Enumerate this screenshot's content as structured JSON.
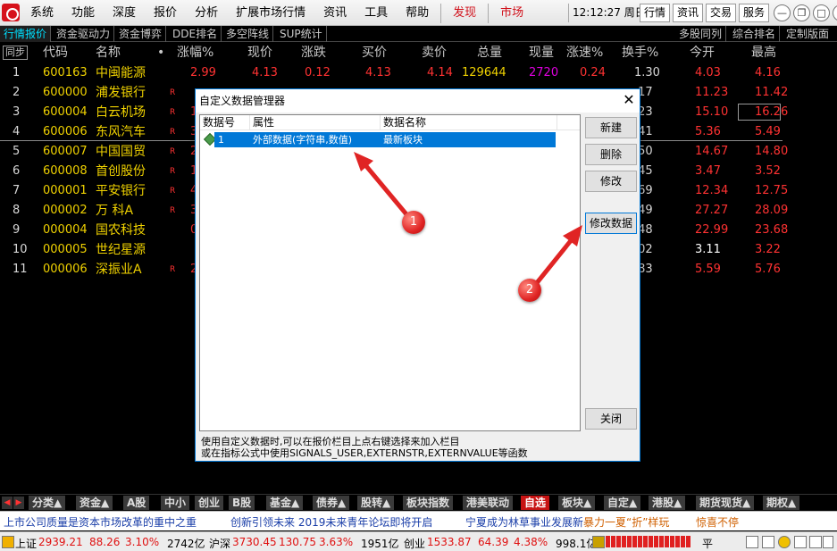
{
  "menu": [
    "系统",
    "功能",
    "深度",
    "报价",
    "分析",
    "扩展市场行情",
    "资讯",
    "工具",
    "帮助"
  ],
  "menu_red": [
    "发现",
    "市场"
  ],
  "clock": "12:12:27 周日",
  "top_buttons": [
    "行情",
    "资讯",
    "交易",
    "服务"
  ],
  "win_controls": [
    "—",
    "❐",
    "□",
    "✕"
  ],
  "tabs": [
    "行情报价",
    "资金驱动力",
    "资金博弈",
    "DDE排名",
    "多空阵线",
    "SUP统计"
  ],
  "tabs_right": [
    "多股同列",
    "综合排名",
    "定制版面"
  ],
  "sync": "同步",
  "columns": [
    "代码",
    "名称",
    "•",
    "涨幅%",
    "现价",
    "涨跌",
    "买价",
    "卖价",
    "总量",
    "现量",
    "涨速%",
    "换手%",
    "今开",
    "最高"
  ],
  "rows": [
    {
      "no": "1",
      "code": "600163",
      "name": "中闽能源",
      "mark": "",
      "pct": "2.99",
      "price": "4.13",
      "chg": "0.12",
      "bid": "4.13",
      "ask": "4.14",
      "vol": "129644",
      "cur": "2720",
      "spd": "0.24",
      "turn": "1.30",
      "open": "4.03",
      "high": "4.16"
    },
    {
      "no": "2",
      "code": "600000",
      "name": "浦发银行",
      "mark": "R",
      "pct": "",
      "price": "",
      "chg": "",
      "bid": "",
      "ask": "",
      "vol": "",
      "cur": "",
      "spd": "",
      "turn": ".17",
      "open": "11.23",
      "high": "11.42"
    },
    {
      "no": "3",
      "code": "600004",
      "name": "白云机场",
      "mark": "R",
      "pct": "10",
      "price": "",
      "chg": "",
      "bid": "",
      "ask": "",
      "vol": "",
      "cur": "",
      "spd": "",
      "turn": ".23",
      "open": "15.10",
      "high": "16.26"
    },
    {
      "no": "4",
      "code": "600006",
      "name": "东风汽车",
      "mark": "R",
      "pct": "3",
      "price": "",
      "chg": "",
      "bid": "",
      "ask": "",
      "vol": "",
      "cur": "",
      "spd": "",
      "turn": ".41",
      "open": "5.36",
      "high": "5.49"
    },
    {
      "no": "5",
      "code": "600007",
      "name": "中国国贸",
      "mark": "R",
      "pct": "2",
      "price": "",
      "chg": "",
      "bid": "",
      "ask": "",
      "vol": "",
      "cur": "",
      "spd": "",
      "turn": ".50",
      "open": "14.67",
      "high": "14.80"
    },
    {
      "no": "6",
      "code": "600008",
      "name": "首创股份",
      "mark": "R",
      "pct": "1",
      "price": "",
      "chg": "",
      "bid": "",
      "ask": "",
      "vol": "",
      "cur": "",
      "spd": "",
      "turn": ".45",
      "open": "3.47",
      "high": "3.52"
    },
    {
      "no": "7",
      "code": "000001",
      "name": "平安银行",
      "mark": "R",
      "pct": "4",
      "price": "",
      "chg": "",
      "bid": "",
      "ask": "",
      "vol": "",
      "cur": "",
      "spd": "",
      "turn": ".69",
      "open": "12.34",
      "high": "12.75"
    },
    {
      "no": "8",
      "code": "000002",
      "name": "万 科A",
      "mark": "R",
      "pct": "3",
      "price": "",
      "chg": "",
      "bid": "",
      "ask": "",
      "vol": "",
      "cur": "",
      "spd": "",
      "turn": ".49",
      "open": "27.27",
      "high": "28.09"
    },
    {
      "no": "9",
      "code": "000004",
      "name": "国农科技",
      "mark": "",
      "pct": "0",
      "price": "",
      "chg": "",
      "bid": "",
      "ask": "",
      "vol": "",
      "cur": "",
      "spd": "",
      "turn": ".48",
      "open": "22.99",
      "high": "23.68"
    },
    {
      "no": "10",
      "code": "000005",
      "name": "世纪星源",
      "mark": "",
      "pct": "",
      "price": "",
      "chg": "",
      "bid": "",
      "ask": "",
      "vol": "",
      "cur": "",
      "spd": "",
      "turn": ".02",
      "open": "3.11",
      "high": "3.22"
    },
    {
      "no": "11",
      "code": "000006",
      "name": "深振业A",
      "mark": "R",
      "pct": "2",
      "price": "",
      "chg": "",
      "bid": "",
      "ask": "",
      "vol": "",
      "cur": "",
      "spd": "",
      "turn": ".83",
      "open": "5.59",
      "high": "5.76"
    }
  ],
  "dialog": {
    "title": "自定义数据管理器",
    "close": "✕",
    "list_headers": [
      "数据号",
      "属性",
      "数据名称"
    ],
    "item": {
      "id": "1",
      "attr": "外部数据(字符串,数值)",
      "name": "最新板块"
    },
    "buttons": [
      "新建",
      "删除",
      "修改",
      "修改数据",
      "关闭"
    ],
    "help_line1": "使用自定义数据时,可以在报价栏目上点右键选择来加入栏目",
    "help_line2": "或在指标公式中使用SIGNALS_USER,EXTERNSTR,EXTERNVALUE等函数"
  },
  "callouts": [
    "1",
    "2"
  ],
  "bottom_tabs": [
    "分类▲",
    "资金▲",
    "A股",
    "中小",
    "创业",
    "B股",
    "基金▲",
    "债券▲",
    "股转▲",
    "板块指数",
    "港美联动",
    "自选",
    "板块▲",
    "自定▲",
    "港股▲",
    "期货现货▲",
    "期权▲"
  ],
  "news": [
    "上市公司质量是资本市场改革的重中之重",
    "创新引领未来 2019未来青年论坛即将开启",
    "宁夏成为林草事业发展新",
    "暴力一夏“折”样玩",
    "惊喜不停"
  ],
  "status": {
    "sh_label": "上证",
    "sh_val": "2939.21",
    "sh_chg": "88.26",
    "sh_pct": "3.10%",
    "sh_amt": "2742亿",
    "sz_label": "沪深",
    "sz_val": "3730.45",
    "sz_chg": "130.75",
    "sz_pct": "3.63%",
    "sz_amt": "1951亿",
    "cy_label": "创业",
    "cy_val": "1533.87",
    "cy_chg": "64.39",
    "cy_pct": "4.38%",
    "cy_amt": "998.1亿",
    "flat": "平"
  }
}
